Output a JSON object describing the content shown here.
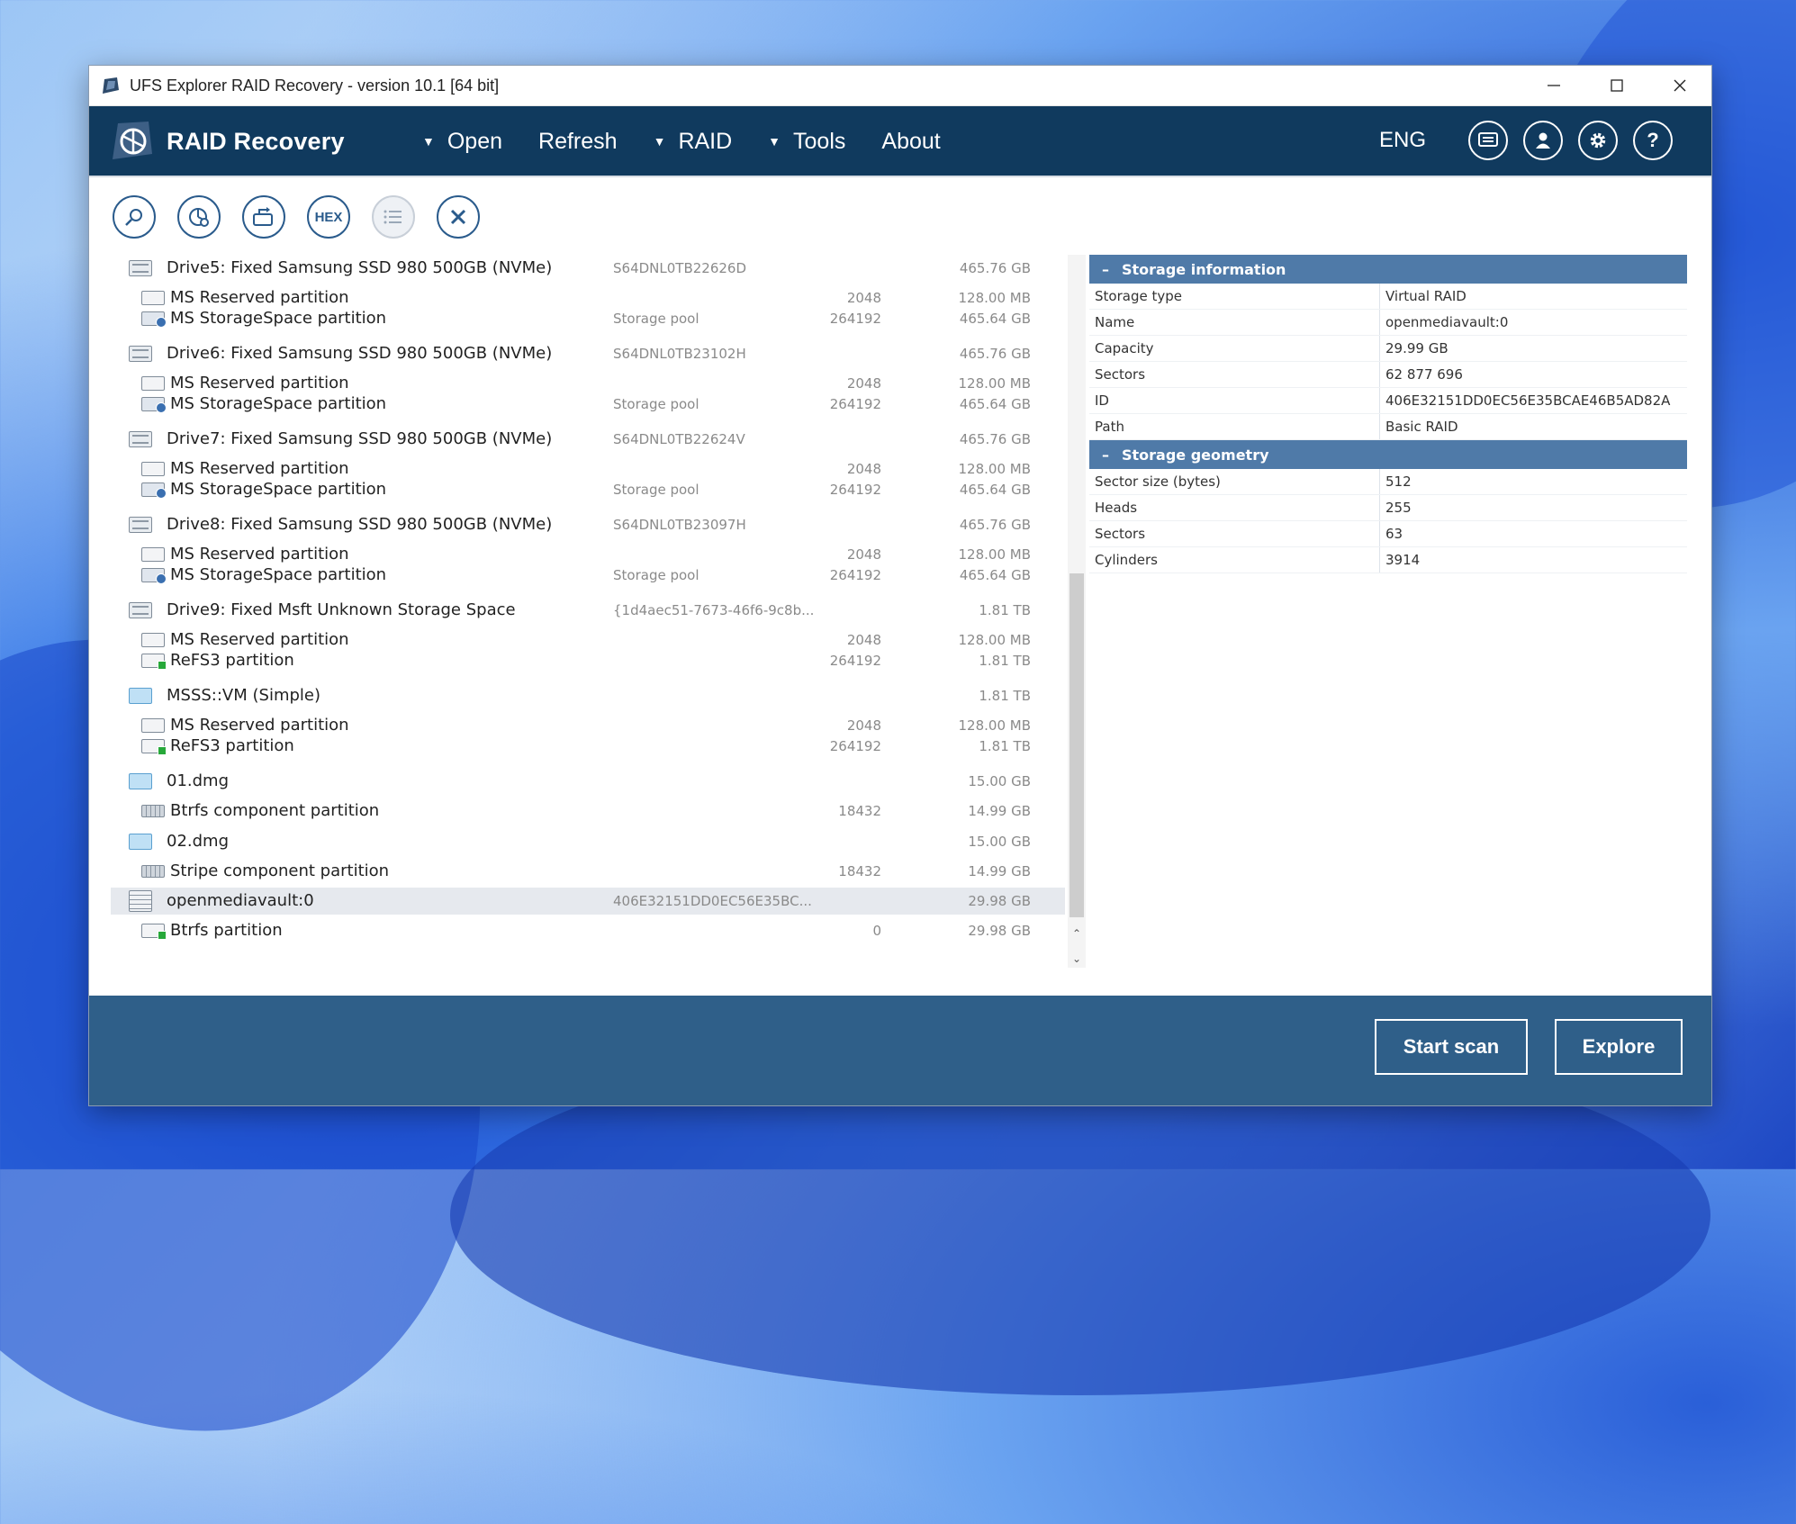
{
  "window": {
    "title": "UFS Explorer RAID Recovery - version 10.1 [64 bit]"
  },
  "menubar": {
    "logo_text": "RAID Recovery",
    "items": [
      "Open",
      "Refresh",
      "RAID",
      "Tools",
      "About"
    ],
    "language": "ENG"
  },
  "toolbar": {
    "hex_label": "HEX"
  },
  "tree": [
    {
      "type": "disk",
      "name": "Drive5: Fixed Samsung SSD 980 500GB (NVMe)",
      "info": "S64DNL0TB22626D",
      "start": "",
      "size": "465.76 GB"
    },
    {
      "type": "part",
      "name": "MS Reserved partition",
      "info": "",
      "start": "2048",
      "size": "128.00 MB"
    },
    {
      "type": "pool",
      "name": "MS StorageSpace partition",
      "info": "Storage pool",
      "start": "264192",
      "size": "465.64 GB"
    },
    {
      "type": "disk",
      "name": "Drive6: Fixed Samsung SSD 980 500GB (NVMe)",
      "info": "S64DNL0TB23102H",
      "start": "",
      "size": "465.76 GB"
    },
    {
      "type": "part",
      "name": "MS Reserved partition",
      "info": "",
      "start": "2048",
      "size": "128.00 MB"
    },
    {
      "type": "pool",
      "name": "MS StorageSpace partition",
      "info": "Storage pool",
      "start": "264192",
      "size": "465.64 GB"
    },
    {
      "type": "disk",
      "name": "Drive7: Fixed Samsung SSD 980 500GB (NVMe)",
      "info": "S64DNL0TB22624V",
      "start": "",
      "size": "465.76 GB"
    },
    {
      "type": "part",
      "name": "MS Reserved partition",
      "info": "",
      "start": "2048",
      "size": "128.00 MB"
    },
    {
      "type": "pool",
      "name": "MS StorageSpace partition",
      "info": "Storage pool",
      "start": "264192",
      "size": "465.64 GB"
    },
    {
      "type": "disk",
      "name": "Drive8: Fixed Samsung SSD 980 500GB (NVMe)",
      "info": "S64DNL0TB23097H",
      "start": "",
      "size": "465.76 GB"
    },
    {
      "type": "part",
      "name": "MS Reserved partition",
      "info": "",
      "start": "2048",
      "size": "128.00 MB"
    },
    {
      "type": "pool",
      "name": "MS StorageSpace partition",
      "info": "Storage pool",
      "start": "264192",
      "size": "465.64 GB"
    },
    {
      "type": "disk",
      "name": "Drive9: Fixed Msft Unknown Storage Space",
      "info": "{1d4aec51-7673-46f6-9c8b...",
      "start": "",
      "size": "1.81 TB"
    },
    {
      "type": "part",
      "name": "MS Reserved partition",
      "info": "",
      "start": "2048",
      "size": "128.00 MB"
    },
    {
      "type": "refs",
      "name": "ReFS3 partition",
      "info": "",
      "start": "264192",
      "size": "1.81 TB"
    },
    {
      "type": "img",
      "name": "MSSS::VM (Simple)",
      "info": "",
      "start": "",
      "size": "1.81 TB"
    },
    {
      "type": "part",
      "name": "MS Reserved partition",
      "info": "",
      "start": "2048",
      "size": "128.00 MB"
    },
    {
      "type": "refs",
      "name": "ReFS3 partition",
      "info": "",
      "start": "264192",
      "size": "1.81 TB"
    },
    {
      "type": "img",
      "name": "01.dmg",
      "info": "",
      "start": "",
      "size": "15.00 GB"
    },
    {
      "type": "grid",
      "name": "Btrfs component partition",
      "info": "",
      "start": "18432",
      "size": "14.99 GB"
    },
    {
      "type": "img",
      "name": "02.dmg",
      "info": "",
      "start": "",
      "size": "15.00 GB"
    },
    {
      "type": "grid",
      "name": "Stripe component partition",
      "info": "",
      "start": "18432",
      "size": "14.99 GB"
    },
    {
      "type": "raid",
      "name": "openmediavault:0",
      "info": "406E32151DD0EC56E35BC...",
      "start": "",
      "size": "29.98 GB",
      "selected": true
    },
    {
      "type": "refs",
      "name": "Btrfs partition",
      "info": "",
      "start": "0",
      "size": "29.98 GB"
    }
  ],
  "storage_information": {
    "title": "Storage information",
    "rows": [
      {
        "k": "Storage type",
        "v": "Virtual RAID"
      },
      {
        "k": "Name",
        "v": "openmediavault:0"
      },
      {
        "k": "Capacity",
        "v": "29.99 GB"
      },
      {
        "k": "Sectors",
        "v": "62 877 696"
      },
      {
        "k": "ID",
        "v": "406E32151DD0EC56E35BCAE46B5AD82A"
      },
      {
        "k": "Path",
        "v": "Basic RAID"
      }
    ]
  },
  "storage_geometry": {
    "title": "Storage geometry",
    "rows": [
      {
        "k": "Sector size (bytes)",
        "v": "512"
      },
      {
        "k": "Heads",
        "v": "255"
      },
      {
        "k": "Sectors",
        "v": "63"
      },
      {
        "k": "Cylinders",
        "v": "3914"
      }
    ]
  },
  "footer": {
    "start_scan": "Start scan",
    "explore": "Explore"
  }
}
